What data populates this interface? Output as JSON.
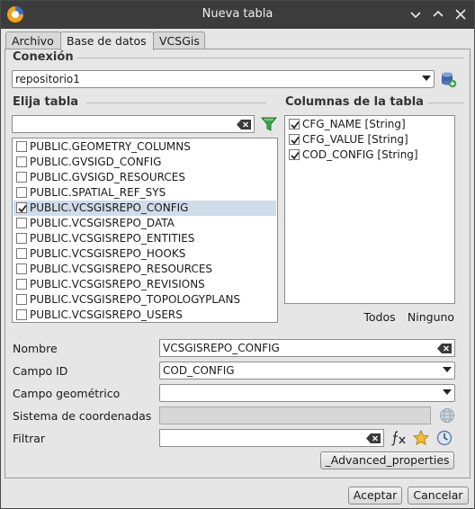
{
  "window": {
    "title": "Nueva tabla"
  },
  "tabs": [
    {
      "label": "Archivo"
    },
    {
      "label": "Base de datos"
    },
    {
      "label": "VCSGis"
    }
  ],
  "connection": {
    "label": "Conexión",
    "value": "repositorio1"
  },
  "tables": {
    "label": "Elija tabla",
    "filter_value": "",
    "items": [
      {
        "name": "PUBLIC.GEOMETRY_COLUMNS",
        "checked": false
      },
      {
        "name": "PUBLIC.GVSIGD_CONFIG",
        "checked": false
      },
      {
        "name": "PUBLIC.GVSIGD_RESOURCES",
        "checked": false
      },
      {
        "name": "PUBLIC.SPATIAL_REF_SYS",
        "checked": false
      },
      {
        "name": "PUBLIC.VCSGISREPO_CONFIG",
        "checked": true
      },
      {
        "name": "PUBLIC.VCSGISREPO_DATA",
        "checked": false
      },
      {
        "name": "PUBLIC.VCSGISREPO_ENTITIES",
        "checked": false
      },
      {
        "name": "PUBLIC.VCSGISREPO_HOOKS",
        "checked": false
      },
      {
        "name": "PUBLIC.VCSGISREPO_RESOURCES",
        "checked": false
      },
      {
        "name": "PUBLIC.VCSGISREPO_REVISIONS",
        "checked": false
      },
      {
        "name": "PUBLIC.VCSGISREPO_TOPOLOGYPLANS",
        "checked": false
      },
      {
        "name": "PUBLIC.VCSGISREPO_USERS",
        "checked": false
      }
    ]
  },
  "columns": {
    "label": "Columnas de la tabla",
    "items": [
      {
        "name": "CFG_NAME [String]",
        "checked": true
      },
      {
        "name": "CFG_VALUE [String]",
        "checked": true
      },
      {
        "name": "COD_CONFIG [String]",
        "checked": true
      }
    ],
    "all_label": "Todos",
    "none_label": "Ninguno"
  },
  "form": {
    "name_label": "Nombre",
    "name_value": "VCSGISREPO_CONFIG",
    "id_field_label": "Campo ID",
    "id_field_value": "COD_CONFIG",
    "geom_field_label": "Campo geométrico",
    "geom_field_value": "",
    "crs_label": "Sistema de coordenadas",
    "crs_value": "",
    "filter_label": "Filtrar",
    "filter_value": "",
    "advanced_label": "_Advanced_properties"
  },
  "footer": {
    "accept_label": "Aceptar",
    "cancel_label": "Cancelar"
  },
  "colors": {
    "titlebar": "#3c3c3c",
    "panel": "#e6e6e6",
    "selection": "#cfdcea",
    "accent": "#2a6fcf"
  }
}
